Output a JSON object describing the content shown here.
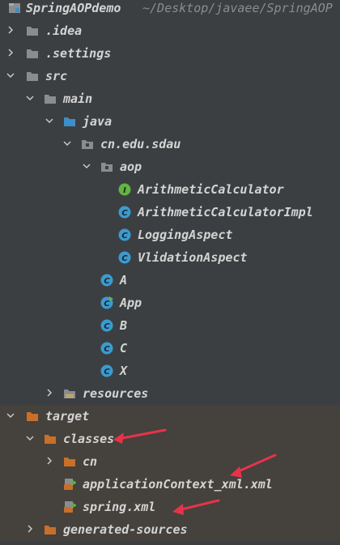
{
  "project": {
    "name": "SpringAOPdemo",
    "path": "~/Desktop/javaee/SpringAOP"
  },
  "tree": {
    "idea": ".idea",
    "settings": ".settings",
    "src": "src",
    "main": "main",
    "java": "java",
    "package": "cn.edu.sdau",
    "aop": "aop",
    "aop_items": [
      "ArithmeticCalculator",
      "ArithmeticCalculatorImpl",
      "LoggingAspect",
      "VlidationAspect"
    ],
    "pkg_items": [
      "A",
      "App",
      "B",
      "C",
      "X"
    ],
    "resources": "resources",
    "target": "target",
    "classes": "classes",
    "cn": "cn",
    "app_ctx": "applicationContext_xml.xml",
    "spring_xml": "spring.xml",
    "generated": "generated-sources"
  },
  "icons": {
    "folder": "folder-icon",
    "interface": "interface-icon",
    "class": "class-icon",
    "xml": "xml-config-icon"
  },
  "colors": {
    "background": "#3c3f41",
    "target_bg": "#45413c",
    "folder_grey": "#8a8d90",
    "folder_blue": "#3d8ec9",
    "folder_orange": "#c86f2a",
    "class_blue": "#3b9bd0",
    "interface_green": "#62b543",
    "annotation_red": "#e8324b"
  }
}
